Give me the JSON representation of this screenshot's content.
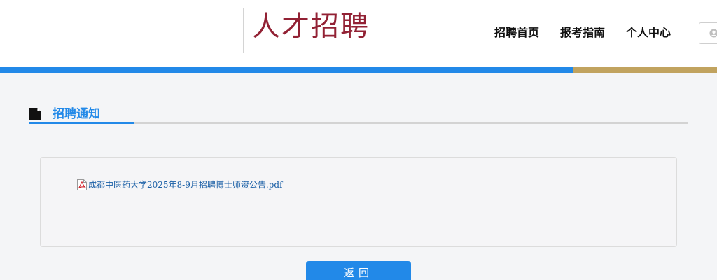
{
  "header": {
    "logo_title": "人才招聘",
    "nav": {
      "home": "招聘首页",
      "guide": "报考指南",
      "personal_center": "个人中心"
    },
    "user_icon": "user-icon"
  },
  "section": {
    "icon": "document-icon",
    "title": "招聘通知"
  },
  "attachment": {
    "icon": "pdf-icon",
    "link_text": "成都中医药大学2025年8-9月招聘博士师资公告.pdf"
  },
  "back_button": {
    "label": "返回"
  },
  "colors": {
    "brand_red": "#922134",
    "accent_blue": "#2289e8",
    "accent_gold": "#c1a35f",
    "link_blue": "#1a5fa6"
  }
}
